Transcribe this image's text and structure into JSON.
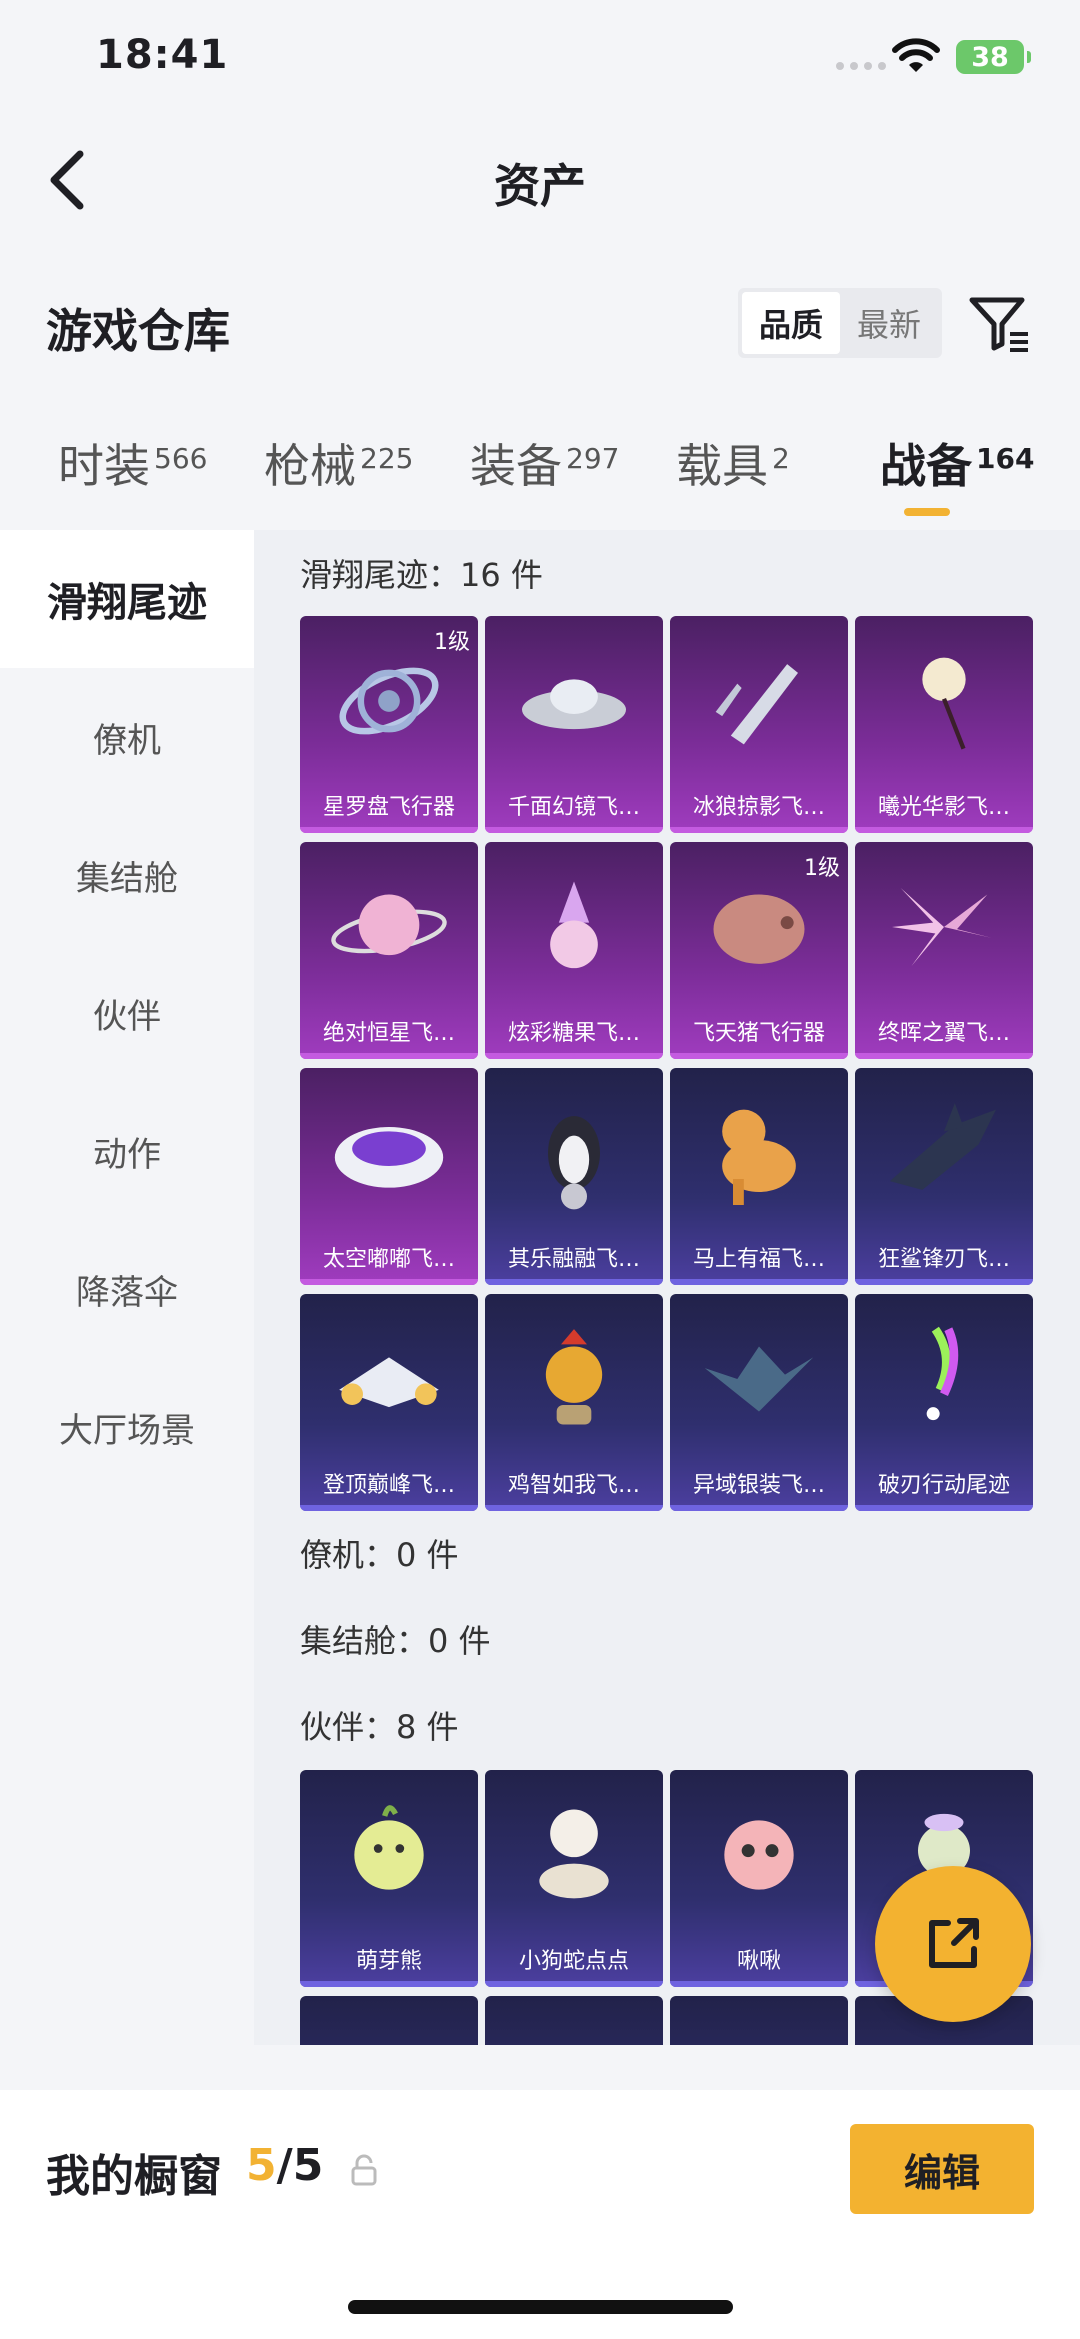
{
  "status_bar": {
    "time": "18:41",
    "battery": "38"
  },
  "nav": {
    "title": "资产"
  },
  "warehouse": {
    "title": "游戏仓库",
    "sort_options": [
      "品质",
      "最新"
    ]
  },
  "tabs": [
    {
      "label": "时装",
      "count": "566"
    },
    {
      "label": "枪械",
      "count": "225"
    },
    {
      "label": "装备",
      "count": "297"
    },
    {
      "label": "载具",
      "count": "2"
    },
    {
      "label": "战备",
      "count": "164"
    }
  ],
  "sidebar": {
    "items": [
      {
        "label": "滑翔尾迹"
      },
      {
        "label": "僚机"
      },
      {
        "label": "集结舱"
      },
      {
        "label": "伙伴"
      },
      {
        "label": "动作"
      },
      {
        "label": "降落伞"
      },
      {
        "label": "大厅场景"
      }
    ]
  },
  "sections": {
    "glide": {
      "title": "滑翔尾迹：16 件",
      "items": [
        {
          "name": "星罗盘飞行器",
          "level": "1级",
          "rarity": "purple",
          "icon": "orbit-ring-icon"
        },
        {
          "name": "千面幻镜飞…",
          "level": "",
          "rarity": "purple",
          "icon": "ufo-icon"
        },
        {
          "name": "冰狼掠影飞…",
          "level": "",
          "rarity": "purple",
          "icon": "ice-shard-icon"
        },
        {
          "name": "曦光华影飞…",
          "level": "",
          "rarity": "purple",
          "icon": "flower-icon"
        },
        {
          "name": "绝对恒星飞…",
          "level": "",
          "rarity": "purple",
          "icon": "planet-icon"
        },
        {
          "name": "炫彩糖果飞…",
          "level": "",
          "rarity": "purple",
          "icon": "candy-icon"
        },
        {
          "name": "飞天猪飞行器",
          "level": "1级",
          "rarity": "purple",
          "icon": "pig-icon"
        },
        {
          "name": "终晖之翼飞…",
          "level": "",
          "rarity": "purple",
          "icon": "wing-icon"
        },
        {
          "name": "太空嘟嘟飞…",
          "level": "",
          "rarity": "purple",
          "icon": "saucer-icon"
        },
        {
          "name": "其乐融融飞…",
          "level": "",
          "rarity": "blue",
          "icon": "penguin-icon"
        },
        {
          "name": "马上有福飞…",
          "level": "",
          "rarity": "blue",
          "icon": "horse-icon"
        },
        {
          "name": "狂鲨锋刃飞…",
          "level": "",
          "rarity": "blue",
          "icon": "shark-icon"
        },
        {
          "name": "登顶巅峰飞…",
          "level": "",
          "rarity": "blue",
          "icon": "jet-icon"
        },
        {
          "name": "鸡智如我飞…",
          "level": "",
          "rarity": "blue",
          "icon": "chicken-icon"
        },
        {
          "name": "异域银装飞…",
          "level": "",
          "rarity": "blue",
          "icon": "bat-wing-icon"
        },
        {
          "name": "破刃行动尾迹",
          "level": "",
          "rarity": "blue",
          "icon": "smoke-trail-icon"
        }
      ]
    },
    "wingman": {
      "title": "僚机：0 件"
    },
    "pod": {
      "title": "集结舱：0 件"
    },
    "partner": {
      "title": "伙伴：8 件",
      "items": [
        {
          "name": "萌芽熊",
          "rarity": "blue",
          "icon": "bear-icon"
        },
        {
          "name": "小狗蛇点点",
          "rarity": "blue",
          "icon": "snake-icon"
        },
        {
          "name": "啾啾",
          "rarity": "blue",
          "icon": "bird-icon"
        },
        {
          "name": "",
          "rarity": "blue",
          "icon": "creature-icon"
        }
      ]
    }
  },
  "showcase": {
    "title": "我的橱窗",
    "used": "5",
    "sep_total": "/5",
    "edit_label": "编辑"
  },
  "colors": {
    "accent": "#f3b230",
    "purple_card": "#7c2d99",
    "blue_card": "#2f2f6e"
  }
}
